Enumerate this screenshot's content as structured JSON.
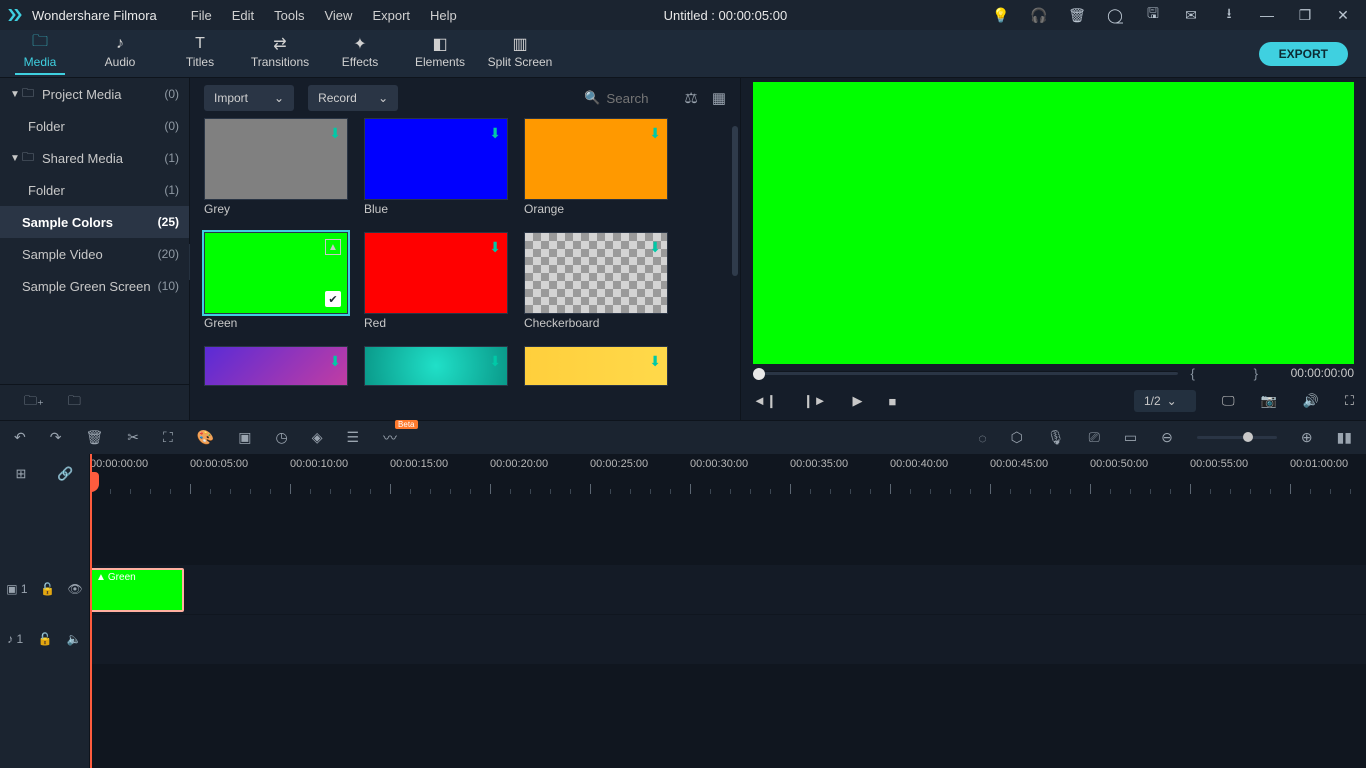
{
  "titlebar": {
    "brand": "Wondershare Filmora",
    "menus": [
      "File",
      "Edit",
      "Tools",
      "View",
      "Export",
      "Help"
    ],
    "doc_title": "Untitled : 00:00:05:00"
  },
  "tabs": {
    "items": [
      "Media",
      "Audio",
      "Titles",
      "Transitions",
      "Effects",
      "Elements",
      "Split Screen"
    ],
    "active": 0,
    "export_label": "EXPORT"
  },
  "sidebar": {
    "items": [
      {
        "label": "Project Media",
        "count": "(0)",
        "chev": true,
        "folder": true
      },
      {
        "label": "Folder",
        "count": "(0)",
        "indent": true
      },
      {
        "label": "Shared Media",
        "count": "(1)",
        "chev": true,
        "folder": true
      },
      {
        "label": "Folder",
        "count": "(1)",
        "indent": true
      },
      {
        "label": "Sample Colors",
        "count": "(25)",
        "selected": true
      },
      {
        "label": "Sample Video",
        "count": "(20)"
      },
      {
        "label": "Sample Green Screen",
        "count": "(10)"
      }
    ]
  },
  "media_toolbar": {
    "import_label": "Import",
    "record_label": "Record",
    "search_placeholder": "Search"
  },
  "media_items": [
    {
      "name": "Grey",
      "color": "#808080",
      "dl": true
    },
    {
      "name": "Blue",
      "color": "#0000ff",
      "dl": true
    },
    {
      "name": "Orange",
      "color": "#ff9900",
      "dl": true
    },
    {
      "name": "Green",
      "color": "#00ff00",
      "selected": true
    },
    {
      "name": "Red",
      "color": "#ff0000",
      "dl": true
    },
    {
      "name": "Checkerboard",
      "checker": true,
      "dl": true
    },
    {
      "name": "",
      "grad": "grad-purple",
      "dl": true,
      "half": true
    },
    {
      "name": "",
      "grad": "grad-teal",
      "dl": true,
      "half": true
    },
    {
      "name": "",
      "grad": "grad-yellow",
      "dl": true,
      "half": true
    }
  ],
  "preview": {
    "braces": "{}",
    "time": "00:00:00:00",
    "ratio": "1/2"
  },
  "ruler": {
    "labels": [
      "00:00:00:00",
      "00:00:05:00",
      "00:00:10:00",
      "00:00:15:00",
      "00:00:20:00",
      "00:00:25:00",
      "00:00:30:00",
      "00:00:35:00",
      "00:00:40:00",
      "00:00:45:00",
      "00:00:50:00",
      "00:00:55:00",
      "00:01:00:00"
    ],
    "spacing": 100
  },
  "clip": {
    "label": "Green",
    "left": 0,
    "width": 94
  },
  "track_labels": {
    "video": "▣ 1",
    "audio": "♪ 1"
  }
}
